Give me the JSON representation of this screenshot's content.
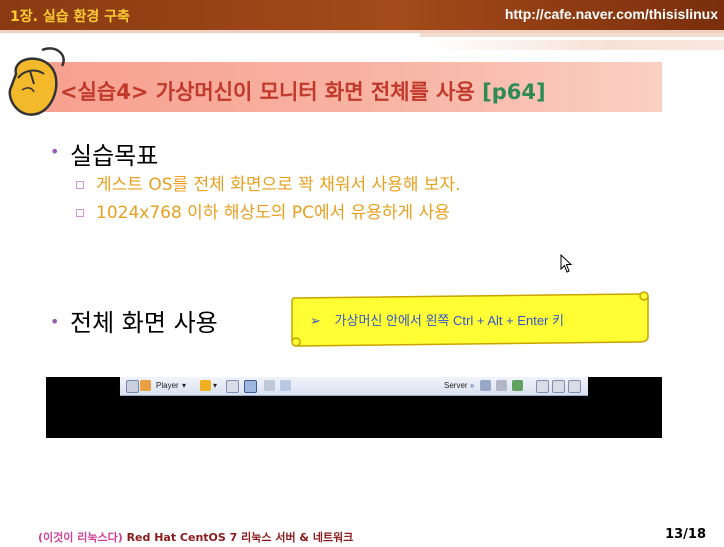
{
  "header": {
    "chapter": "1장. 실습 환경 구축",
    "site": "http://cafe.naver.com/thisislinux"
  },
  "slide": {
    "title_main": "<실습4> 가상머신이 모니터 화면 전체를 사용",
    "title_page": "[p64]",
    "bullet1": "실습목표",
    "sub1": "게스트 OS를 전체 화면으로 꽉 채워서 사용해 보자.",
    "sub2": "1024x768 이하 해상도의 PC에서 유용하게 사용",
    "bullet2": "전체 화면 사용",
    "scroll_arrow": "➢",
    "scroll_text": "가상머신 안에서 왼쪽 Ctrl + Alt + Enter 키"
  },
  "toolbar": {
    "player_label": "Player",
    "server_label": "Server"
  },
  "footer": {
    "book_paren": "(이것이 리눅스다)",
    "book_title": "Red Hat CentOS 7 리눅스 서버 & 네트워크",
    "page": "13/18"
  },
  "colors": {
    "header_bg": "#8a3a12",
    "title_red": "#c0392b",
    "title_green": "#2e8b57",
    "sub_orange": "#e8a020",
    "scroll_yellow": "#ffff33"
  },
  "icons": [
    "mouse-icon",
    "player-icon",
    "pause-icon",
    "fullscreen-icon",
    "network-icon",
    "cursor-icon"
  ]
}
